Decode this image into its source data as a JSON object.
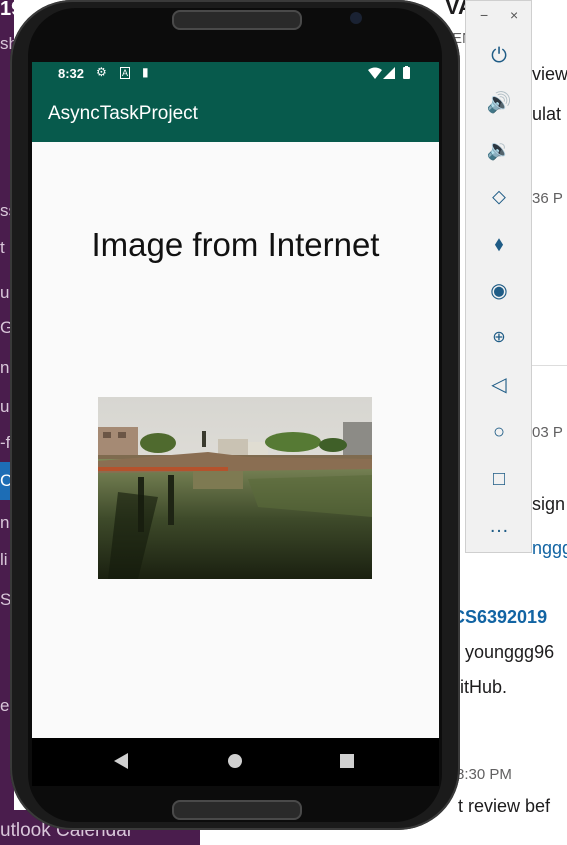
{
  "background": {
    "left_fragments": [
      "19",
      "sh",
      "ss",
      "t",
      "u s",
      "Ga",
      "n",
      "ua",
      "-f",
      "C",
      "nc",
      "li",
      "S",
      "ec"
    ],
    "bottom_text": "utlook Calendar",
    "chat": {
      "name_fragment": "VAN",
      "sub_fragment": "ENG",
      "line1": "eview",
      "line2": "nulat",
      "time1": "36 P",
      "time2": "03 P",
      "assign": "sign",
      "link1": "nggg",
      "repo": "CS6392019",
      "line3": "younggg96",
      "line4": "itHub.",
      "time3": "8:30 PM",
      "line5": "t review bef"
    }
  },
  "statusbar": {
    "time": "8:32",
    "left_icons": [
      "gear-icon",
      "a-icon",
      "sd-card-icon"
    ],
    "right_icons": [
      "wifi-icon",
      "signal-icon",
      "battery-icon"
    ]
  },
  "appbar": {
    "title": "AsyncTaskProject"
  },
  "content": {
    "heading": "Image from Internet"
  },
  "navbar": {
    "icons": [
      "back-icon",
      "home-icon",
      "recents-icon"
    ]
  },
  "emulator_toolbar": {
    "window_controls": [
      "−",
      "×"
    ],
    "buttons": [
      "power-icon",
      "volume-up-icon",
      "volume-down-icon",
      "rotate-left-icon",
      "rotate-right-icon",
      "camera-icon",
      "zoom-icon",
      "back-icon",
      "home-icon",
      "overview-icon",
      "more-icon"
    ]
  },
  "colors": {
    "primary_dark": "#075a4c",
    "accent_link": "#1264a3"
  }
}
